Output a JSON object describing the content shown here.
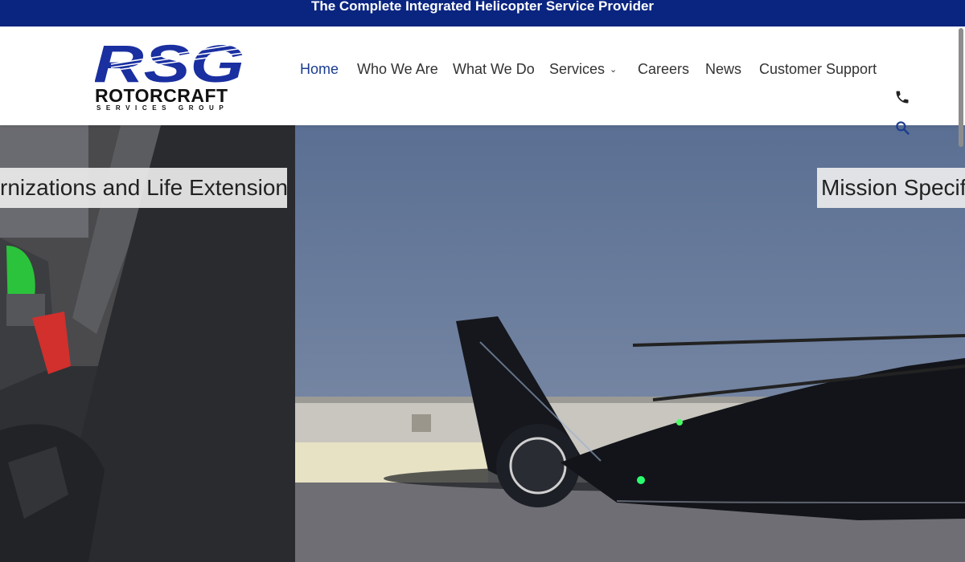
{
  "topbar": {
    "tagline": "The Complete Integrated Helicopter Service Provider"
  },
  "logo": {
    "mark": "RSG",
    "line1": "ROTORCRAFT",
    "line2": "SERVICES GROUP"
  },
  "nav": {
    "items": [
      {
        "label": "Home",
        "active": true
      },
      {
        "label": "Who We Are"
      },
      {
        "label": "What We Do"
      },
      {
        "label": "Services",
        "has_dropdown": true
      },
      {
        "label": "Careers"
      },
      {
        "label": "News"
      },
      {
        "label": "Customer Support"
      }
    ]
  },
  "icons": {
    "phone": "phone-icon",
    "search": "search-icon",
    "dropdown": "chevron-down-icon"
  },
  "hero": {
    "slides": [
      {
        "caption": "rnizations and Life Extension"
      },
      {
        "caption": "Mission Specif"
      }
    ]
  },
  "colors": {
    "brand_blue": "#0a2580",
    "nav_active": "#1b3d8f",
    "logo_blue": "#1a2fa0"
  }
}
